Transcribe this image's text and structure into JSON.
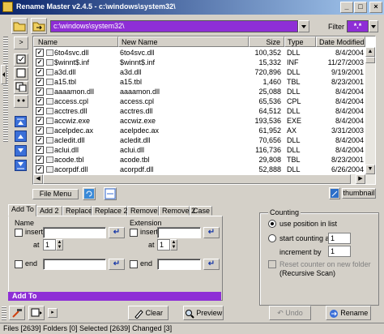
{
  "window": {
    "title": "Rename Master v2.4.5 - c:\\windows\\system32\\",
    "minimize": "_",
    "maximize": "□",
    "close": "×"
  },
  "toolbar": {
    "path": "c:\\windows\\system32\\",
    "filter_label": "Filter",
    "filter_value": "*.*"
  },
  "left_tools": {
    "expand": ">",
    "add_row": "+",
    "remove_row": "-"
  },
  "table": {
    "columns": [
      "Name",
      "New Name",
      "Size",
      "Type",
      "Date Modified"
    ],
    "rows": [
      {
        "name": "6to4svc.dll",
        "new_name": "6to4svc.dll",
        "size": "100,352",
        "type": "DLL",
        "date": "8/4/2004"
      },
      {
        "name": "$winnt$.inf",
        "new_name": "$winnt$.inf",
        "size": "15,332",
        "type": "INF",
        "date": "11/27/2003"
      },
      {
        "name": "a3d.dll",
        "new_name": "a3d.dll",
        "size": "720,896",
        "type": "DLL",
        "date": "9/19/2001"
      },
      {
        "name": "a15.tbl",
        "new_name": "a15.tbl",
        "size": "1,460",
        "type": "TBL",
        "date": "8/23/2001"
      },
      {
        "name": "aaaamon.dll",
        "new_name": "aaaamon.dll",
        "size": "25,088",
        "type": "DLL",
        "date": "8/4/2004"
      },
      {
        "name": "access.cpl",
        "new_name": "access.cpl",
        "size": "65,536",
        "type": "CPL",
        "date": "8/4/2004"
      },
      {
        "name": "acctres.dll",
        "new_name": "acctres.dll",
        "size": "64,512",
        "type": "DLL",
        "date": "8/4/2004"
      },
      {
        "name": "accwiz.exe",
        "new_name": "accwiz.exe",
        "size": "193,536",
        "type": "EXE",
        "date": "8/4/2004"
      },
      {
        "name": "acelpdec.ax",
        "new_name": "acelpdec.ax",
        "size": "61,952",
        "type": "AX",
        "date": "3/31/2003"
      },
      {
        "name": "acledit.dll",
        "new_name": "acledit.dll",
        "size": "70,656",
        "type": "DLL",
        "date": "8/4/2004"
      },
      {
        "name": "aclui.dll",
        "new_name": "aclui.dll",
        "size": "116,736",
        "type": "DLL",
        "date": "8/4/2004"
      },
      {
        "name": "acode.tbl",
        "new_name": "acode.tbl",
        "size": "29,808",
        "type": "TBL",
        "date": "8/23/2001"
      },
      {
        "name": "acorpdf.dll",
        "new_name": "acorpdf.dll",
        "size": "52,888",
        "type": "DLL",
        "date": "6/26/2004"
      }
    ]
  },
  "file_menu_label": "File Menu",
  "thumbnail_label": "thumbnail",
  "tabs": [
    "Add To",
    "Add 2",
    "Replace",
    "Replace 2",
    "Remove",
    "Remove 2",
    "Case"
  ],
  "add_panel": {
    "name_label": "Name",
    "extension_label": "Extension",
    "insert_label": "insert",
    "at_label": "at",
    "end_label": "end",
    "name_at_value": "1",
    "ext_at_value": "1",
    "footer": "Add To"
  },
  "counting": {
    "title": "Counting",
    "use_position": "use position in list",
    "start_counting_at": "start counting at",
    "start_value": "1",
    "increment_by": "increment by",
    "increment_value": "1",
    "reset_counter": "Reset counter on new folder",
    "recursive_scan": "(Recursive Scan)"
  },
  "bottom": {
    "clear": "Clear",
    "preview": "Preview",
    "undo": "Undo",
    "rename": "Rename"
  },
  "status": "Files [2639] Folders [0] Selected [2639] Changed [3]",
  "colors": {
    "accent_purple": "#8e2ed6",
    "title_blue": "#0a246a",
    "face": "#d4d0c8"
  }
}
